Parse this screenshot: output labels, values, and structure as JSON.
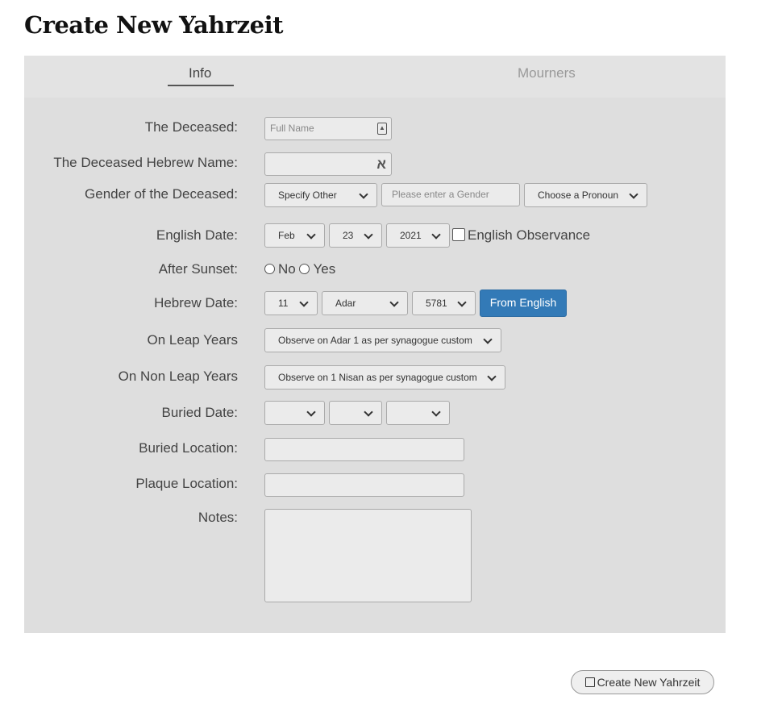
{
  "title": "Create New Yahrzeit",
  "tabs": [
    {
      "label": "Info",
      "active": true
    },
    {
      "label": "Mourners",
      "active": false
    }
  ],
  "form": {
    "deceased": {
      "label": "The Deceased:",
      "placeholder": "Full Name",
      "icon": "contact-card-icon"
    },
    "hebrew_name": {
      "label": "The Deceased Hebrew Name:",
      "icon_glyph": "א"
    },
    "gender": {
      "label": "Gender of the Deceased:",
      "select": "Specify Other",
      "gender_placeholder": "Please enter a Gender",
      "pronoun": "Choose a Pronoun"
    },
    "english_date": {
      "label": "English Date:",
      "month": "Feb",
      "day": "23",
      "year": "2021",
      "observance_label": "English Observance",
      "observance_checked": false
    },
    "after_sunset": {
      "label": "After Sunset:",
      "no": "No",
      "yes": "Yes"
    },
    "hebrew_date": {
      "label": "Hebrew Date:",
      "day": "11",
      "month": "Adar",
      "year": "5781",
      "button": "From English"
    },
    "leap": {
      "label": "On Leap Years",
      "value": "Observe on Adar 1 as per synagogue custom"
    },
    "nonleap": {
      "label": "On Non Leap Years",
      "value": "Observe on 1 Nisan as per synagogue custom"
    },
    "buried_date": {
      "label": "Buried Date:"
    },
    "buried_location": {
      "label": "Buried Location:"
    },
    "plaque_location": {
      "label": "Plaque Location:"
    },
    "notes": {
      "label": "Notes:"
    }
  },
  "submit": "Create New Yahrzeit",
  "colors": {
    "primary": "#337ab7",
    "panel": "#dedede"
  }
}
